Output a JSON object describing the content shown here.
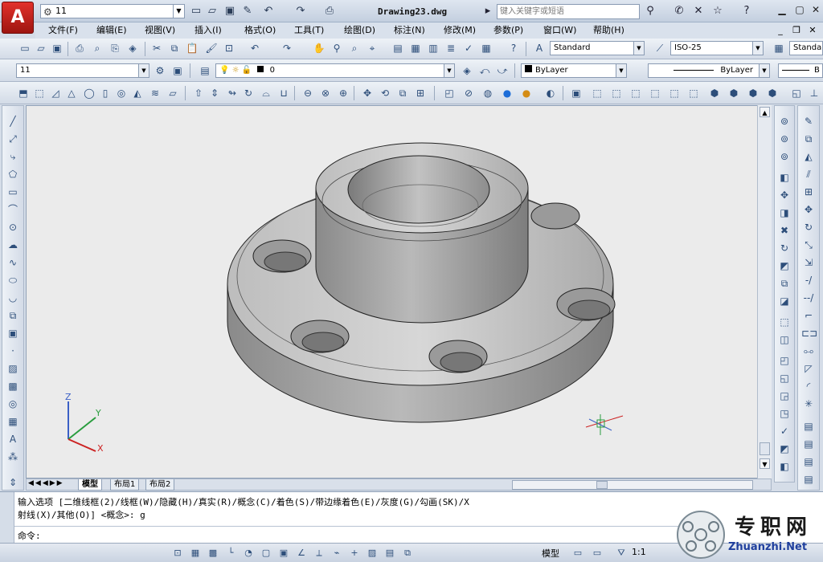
{
  "window": {
    "title": "Drawing23.dwg",
    "workspace": "11",
    "search_placeholder": "键入关键字或短语",
    "help_label": "?"
  },
  "menus": [
    "文件(F)",
    "编辑(E)",
    "视图(V)",
    "插入(I)",
    "格式(O)",
    "工具(T)",
    "绘图(D)",
    "标注(N)",
    "修改(M)",
    "参数(P)",
    "窗口(W)",
    "帮助(H)"
  ],
  "toolbar_styles": {
    "text_style": "Standard",
    "dim_style": "ISO-25",
    "table_style": "Standa"
  },
  "toolbar_layers": {
    "layer_state": "11",
    "layer_name": "0",
    "color": "ByLayer",
    "linetype": "ByLayer",
    "lineweight": "B"
  },
  "tabs": [
    "模型",
    "布局1",
    "布局2"
  ],
  "command": {
    "line1": "输入选项 [二维线框(2)/线框(W)/隐藏(H)/真实(R)/概念(C)/着色(S)/带边缘着色(E)/灰度(G)/勾画(SK)/X",
    "line2": "射线(X)/其他(O)] <概念>: g",
    "prompt": "命令:"
  },
  "status": {
    "space": "模型",
    "scale": "1:1"
  },
  "ucs": {
    "x": "X",
    "y": "Y",
    "z": "Z"
  },
  "watermark": {
    "cn": "专职网",
    "en": "Zhuanzhi.Net"
  },
  "app_logo_letter": "A"
}
